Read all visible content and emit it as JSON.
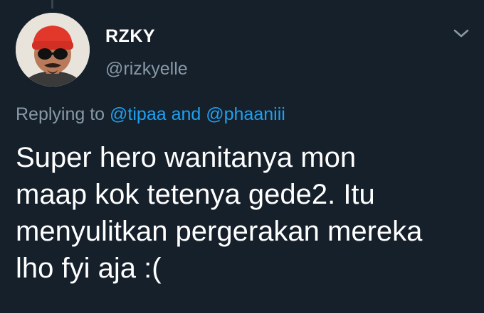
{
  "user": {
    "display_name": "RZKY",
    "username": "@rizkyelle"
  },
  "reply": {
    "prefix": "Replying to",
    "mention_1": "@tipaa",
    "conjunction": "and",
    "mention_2": "@phaaniii"
  },
  "tweet": {
    "lines": [
      "Super hero wanitanya mon",
      "maap kok tetenya gede2. Itu",
      "menyulitkan pergerakan mereka",
      "lho fyi aja :("
    ]
  },
  "icons": {
    "avatar": "profile-photo",
    "more": "chevron-down-icon"
  },
  "colors": {
    "background": "#15202b",
    "text": "#ffffff",
    "secondary_text": "#8899a6",
    "accent": "#1da1f2"
  }
}
